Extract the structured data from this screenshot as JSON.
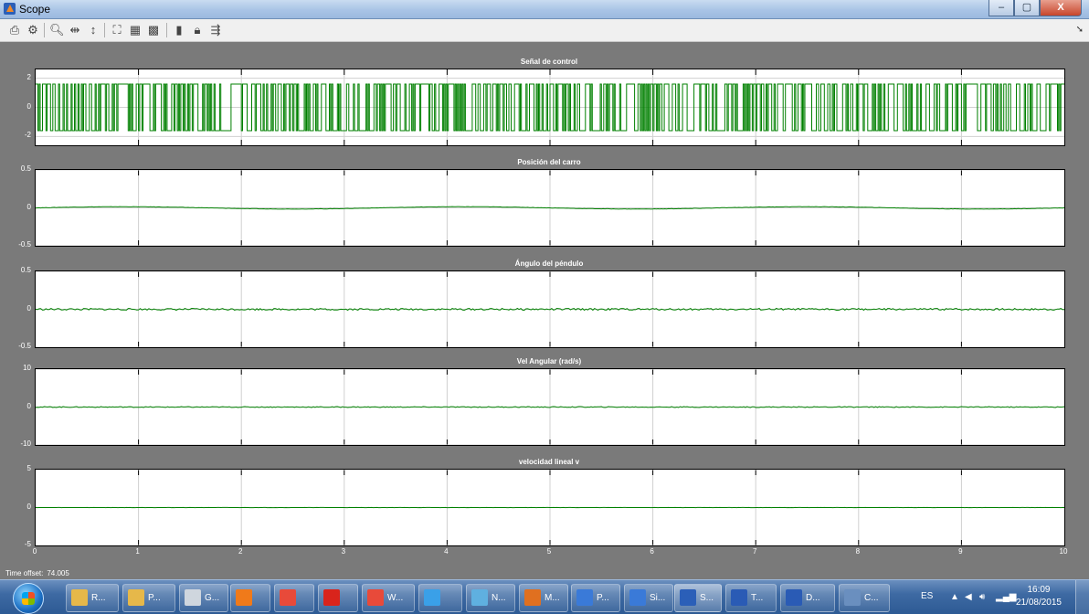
{
  "window": {
    "title": "Scope",
    "min_label": "–",
    "max_label": "▢",
    "close_label": "X"
  },
  "toolbar": {
    "icons": [
      "print-icon",
      "parameters-icon",
      "zoom-icon",
      "zoom-x-icon",
      "zoom-y-icon",
      "autoscale-icon",
      "save-axes-icon",
      "restore-axes-icon",
      "floating-scope-icon",
      "lock-axes-icon",
      "signal-selection-icon"
    ]
  },
  "scope": {
    "time_offset_label": "Time offset:",
    "time_offset_value": "74.005",
    "x_ticks": [
      "0",
      "1",
      "2",
      "3",
      "4",
      "5",
      "6",
      "7",
      "8",
      "9",
      "10"
    ],
    "plots": [
      {
        "title": "Señal de control",
        "y_ticks": [
          "2",
          "0",
          "-2"
        ],
        "ylim": [
          -2.6,
          2.6
        ],
        "signal": "square",
        "amplitude": 1.6
      },
      {
        "title": "Posición del carro",
        "y_ticks": [
          "0.5",
          "0",
          "-0.5"
        ],
        "ylim": [
          -0.5,
          0.5
        ],
        "signal": "slow",
        "amplitude": 0.015
      },
      {
        "title": "Ángulo del péndulo",
        "y_ticks": [
          "0.5",
          "0",
          "-0.5"
        ],
        "ylim": [
          -0.5,
          0.5
        ],
        "signal": "noise",
        "amplitude": 0.012
      },
      {
        "title": "Vel Angular (rad/s)",
        "y_ticks": [
          "10",
          "0",
          "-10"
        ],
        "ylim": [
          -10,
          10
        ],
        "signal": "noise",
        "amplitude": 0.12
      },
      {
        "title": "velocidad lineal v",
        "y_ticks": [
          "5",
          "0",
          "-5"
        ],
        "ylim": [
          -5,
          5
        ],
        "signal": "flat",
        "amplitude": 0.05
      }
    ]
  },
  "colors": {
    "trace": "#008000",
    "background": "#7a7a7a"
  },
  "taskbar": {
    "items": [
      {
        "label": "R...",
        "icon": "folder-icon",
        "color": "#e6b84a"
      },
      {
        "label": "P...",
        "icon": "folder-icon",
        "color": "#e6b84a"
      },
      {
        "label": "G...",
        "icon": "drive-icon",
        "color": "#cfd6de"
      },
      {
        "label": "",
        "icon": "media-player-icon",
        "color": "#f07a1a"
      },
      {
        "label": "",
        "icon": "chrome-icon",
        "color": "#e84a3a"
      },
      {
        "label": "",
        "icon": "acrobat-icon",
        "color": "#d9241c"
      },
      {
        "label": "W...",
        "icon": "chrome-window-icon",
        "color": "#e84a3a"
      },
      {
        "label": "",
        "icon": "ie-icon",
        "color": "#3aa0e8"
      },
      {
        "label": "N...",
        "icon": "network-icon",
        "color": "#5fb0e0"
      },
      {
        "label": "M...",
        "icon": "matlab-icon",
        "color": "#e07020"
      },
      {
        "label": "P...",
        "icon": "presentation-icon",
        "color": "#3a7ad8"
      },
      {
        "label": "Si...",
        "icon": "simulink-icon",
        "color": "#3a7ad8"
      },
      {
        "label": "S...",
        "icon": "scope-icon",
        "color": "#2b5fb8"
      },
      {
        "label": "T...",
        "icon": "word-icon",
        "color": "#2a5bb5"
      },
      {
        "label": "D...",
        "icon": "word-icon",
        "color": "#2a5bb5"
      },
      {
        "label": "C...",
        "icon": "calculator-icon",
        "color": "#6a8fbf"
      }
    ],
    "language": "ES",
    "time": "16:09",
    "date": "21/08/2015"
  }
}
